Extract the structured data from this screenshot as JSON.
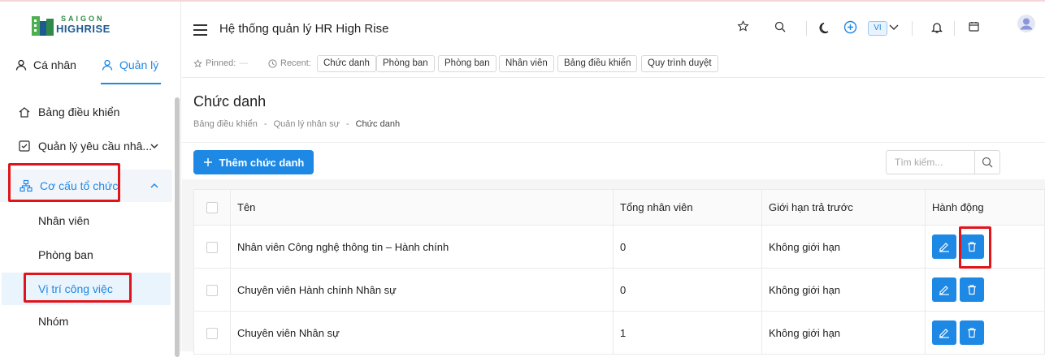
{
  "logo": {
    "line1": "SAIGON",
    "line2": "HIGHRISE"
  },
  "sidebar": {
    "tabs": [
      {
        "label": "Cá nhân"
      },
      {
        "label": "Quản lý"
      }
    ],
    "items": [
      {
        "label": "Bảng điều khiển"
      },
      {
        "label": "Quản lý yêu cầu nhâ..."
      },
      {
        "label": "Cơ cấu tổ chức"
      }
    ],
    "subitems": [
      {
        "label": "Nhân viên"
      },
      {
        "label": "Phòng ban"
      },
      {
        "label": "Vị trí công việc"
      },
      {
        "label": "Nhóm"
      }
    ]
  },
  "header": {
    "title": "Hệ thống quản lý HR High Rise",
    "lang": "VI"
  },
  "pinbar": {
    "pinned_label": "Pinned:",
    "pinned_empty": "—",
    "recent_label": "Recent:",
    "chips": [
      "Chức danh",
      "Phòng ban",
      "Phòng ban",
      "Nhân viên",
      "Bảng điều khiển",
      "Quy trình duyệt"
    ]
  },
  "page": {
    "title": "Chức danh",
    "breadcrumb": [
      "Bảng điều khiển",
      "Quản lý nhân sự",
      "Chức danh"
    ],
    "breadcrumb_sep": "-",
    "add_button": "Thêm chức danh",
    "search_placeholder": "Tìm kiếm..."
  },
  "table": {
    "columns": [
      "Tên",
      "Tổng nhân viên",
      "Giới hạn trả trước",
      "Hành động"
    ],
    "rows": [
      {
        "name": "Nhân viên Công nghệ thông tin – Hành chính",
        "total": "0",
        "limit": "Không giới hạn"
      },
      {
        "name": "Chuyên viên Hành chính Nhân sự",
        "total": "0",
        "limit": "Không giới hạn"
      },
      {
        "name": "Chuyên viên Nhân sự",
        "total": "1",
        "limit": "Không giới hạn"
      }
    ]
  },
  "colors": {
    "accent": "#1e88e5",
    "highlight": "#e0141b"
  }
}
